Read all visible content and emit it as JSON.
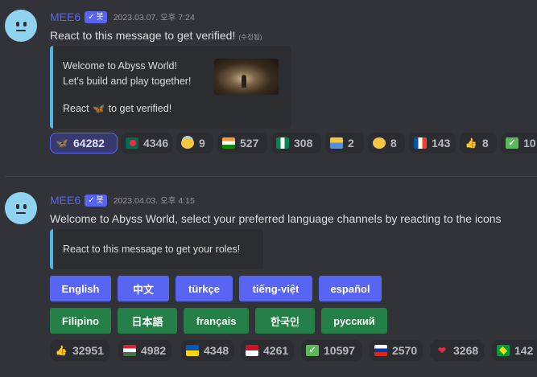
{
  "messages": [
    {
      "username": "MEE6",
      "bot_label": "봇",
      "timestamp": "2023.03.07. 오후 7:24",
      "text": "React to this message to get verified!",
      "edited": "(수정됨)",
      "embed": {
        "line1": "Welcome to Abyss World!",
        "line2": "Let's build and play together!",
        "line3_pre": "React",
        "line3_post": "to get verified!"
      },
      "reactions": [
        {
          "emoji": "butterfly",
          "count": "64282",
          "active": true
        },
        {
          "emoji": "flag-bangladesh",
          "count": "4346"
        },
        {
          "emoji": "smiling-face-with-halo",
          "count": "9"
        },
        {
          "emoji": "flag-india",
          "count": "527"
        },
        {
          "emoji": "flag-nigeria",
          "count": "308"
        },
        {
          "emoji": "person-raising-hand",
          "count": "2"
        },
        {
          "emoji": "grinning-face",
          "count": "8"
        },
        {
          "emoji": "flag-france",
          "count": "143"
        },
        {
          "emoji": "thumbs-up",
          "count": "8"
        },
        {
          "emoji": "check-mark-button",
          "count": "10"
        }
      ]
    },
    {
      "username": "MEE6",
      "bot_label": "봇",
      "timestamp": "2023.04.03. 오후 4:15",
      "text": "Welcome to Abyss World, select your preferred language channels by reacting to the icons",
      "embed": {
        "line1": "React to this message to get your roles!"
      },
      "buttons_row1": [
        "English",
        "中文",
        "türkçe",
        "tiếng-việt",
        "español"
      ],
      "buttons_row2": [
        "Filipino",
        "日本語",
        "français",
        "한국인",
        "русский"
      ],
      "reactions": [
        {
          "emoji": "thumbs-up",
          "count": "32951"
        },
        {
          "emoji": "flag-hungary",
          "count": "4982"
        },
        {
          "emoji": "flag-ukraine",
          "count": "4348"
        },
        {
          "emoji": "flag-indonesia",
          "count": "4261"
        },
        {
          "emoji": "check-mark-button",
          "count": "10597"
        },
        {
          "emoji": "flag-russia",
          "count": "2570"
        },
        {
          "emoji": "red-heart",
          "count": "3268"
        },
        {
          "emoji": "flag-brazil",
          "count": "142"
        }
      ]
    }
  ]
}
